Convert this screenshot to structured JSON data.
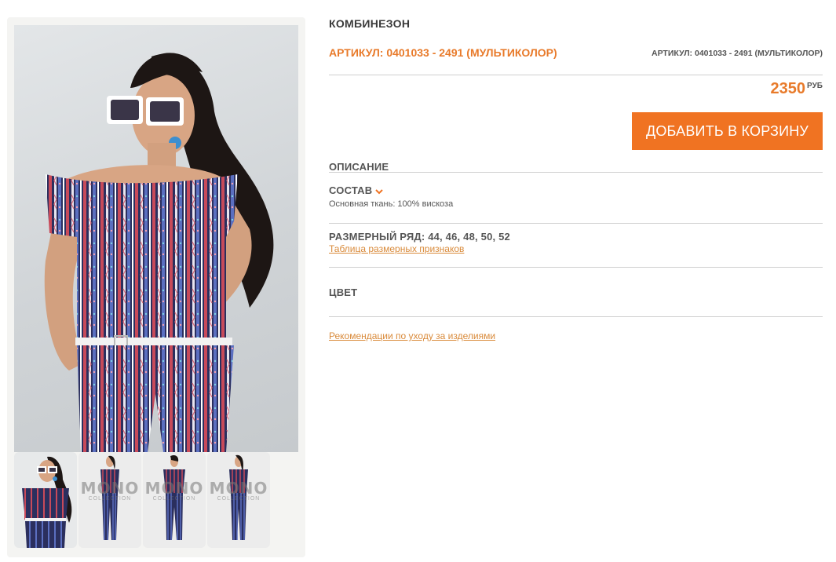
{
  "product": {
    "title": "КОМБИНЕЗОН",
    "article_main": "АРТИКУЛ: 0401033 - 2491 (МУЛЬТИКОЛОР)",
    "article_small": "АРТИКУЛ: 0401033 - 2491 (МУЛЬТИКОЛОР)",
    "price": "2350",
    "currency": "РУБ",
    "add_to_cart_label": "ДОБАВИТЬ В КОРЗИНУ"
  },
  "details": {
    "description_heading": "ОПИСАНИЕ",
    "composition_heading": "СОСТАВ",
    "composition_text": "Основная ткань: 100% вискоза",
    "sizes_heading": "РАЗМЕРНЫЙ РЯД: 44, 46, 48, 50, 52",
    "size_chart_link": "Таблица размерных признаков",
    "color_heading": "ЦВЕТ",
    "care_link": "Рекомендации по уходу за изделиями"
  },
  "gallery": {
    "thumbnails": [
      {
        "watermark": "",
        "selected": true
      },
      {
        "watermark": "MONO",
        "subtitle": "COLLECTION"
      },
      {
        "watermark": "MONO",
        "subtitle": "COLLECTION"
      },
      {
        "watermark": "MONO",
        "subtitle": "COLLECTION"
      }
    ]
  },
  "colors": {
    "accent": "#f07322",
    "accent_text": "#e87a2a",
    "link": "#d98a3a",
    "divider": "#cfcfcf"
  }
}
